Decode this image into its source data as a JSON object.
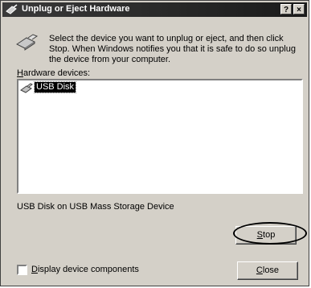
{
  "window": {
    "title": "Unplug or Eject Hardware",
    "help_label": "?",
    "close_label": "×"
  },
  "instructions": "Select the device you want to unplug or eject, and then click Stop. When Windows notifies you that it is safe to do so unplug the device from your computer.",
  "hardware": {
    "label_access": "H",
    "label_rest": "ardware devices:",
    "items": [
      {
        "label": "USB Disk",
        "icon": "usb-drive-icon",
        "selected": true
      }
    ]
  },
  "device_description": "USB Disk on USB Mass Storage Device",
  "buttons": {
    "stop_access": "S",
    "stop_rest": "top",
    "close_access": "C",
    "close_rest": "lose"
  },
  "checkbox": {
    "access": "D",
    "rest": "isplay device components",
    "checked": false
  },
  "colors": {
    "dialog_bg": "#d4d0c8",
    "title_bg": "#2a2a2a",
    "selection_bg": "#000000"
  }
}
